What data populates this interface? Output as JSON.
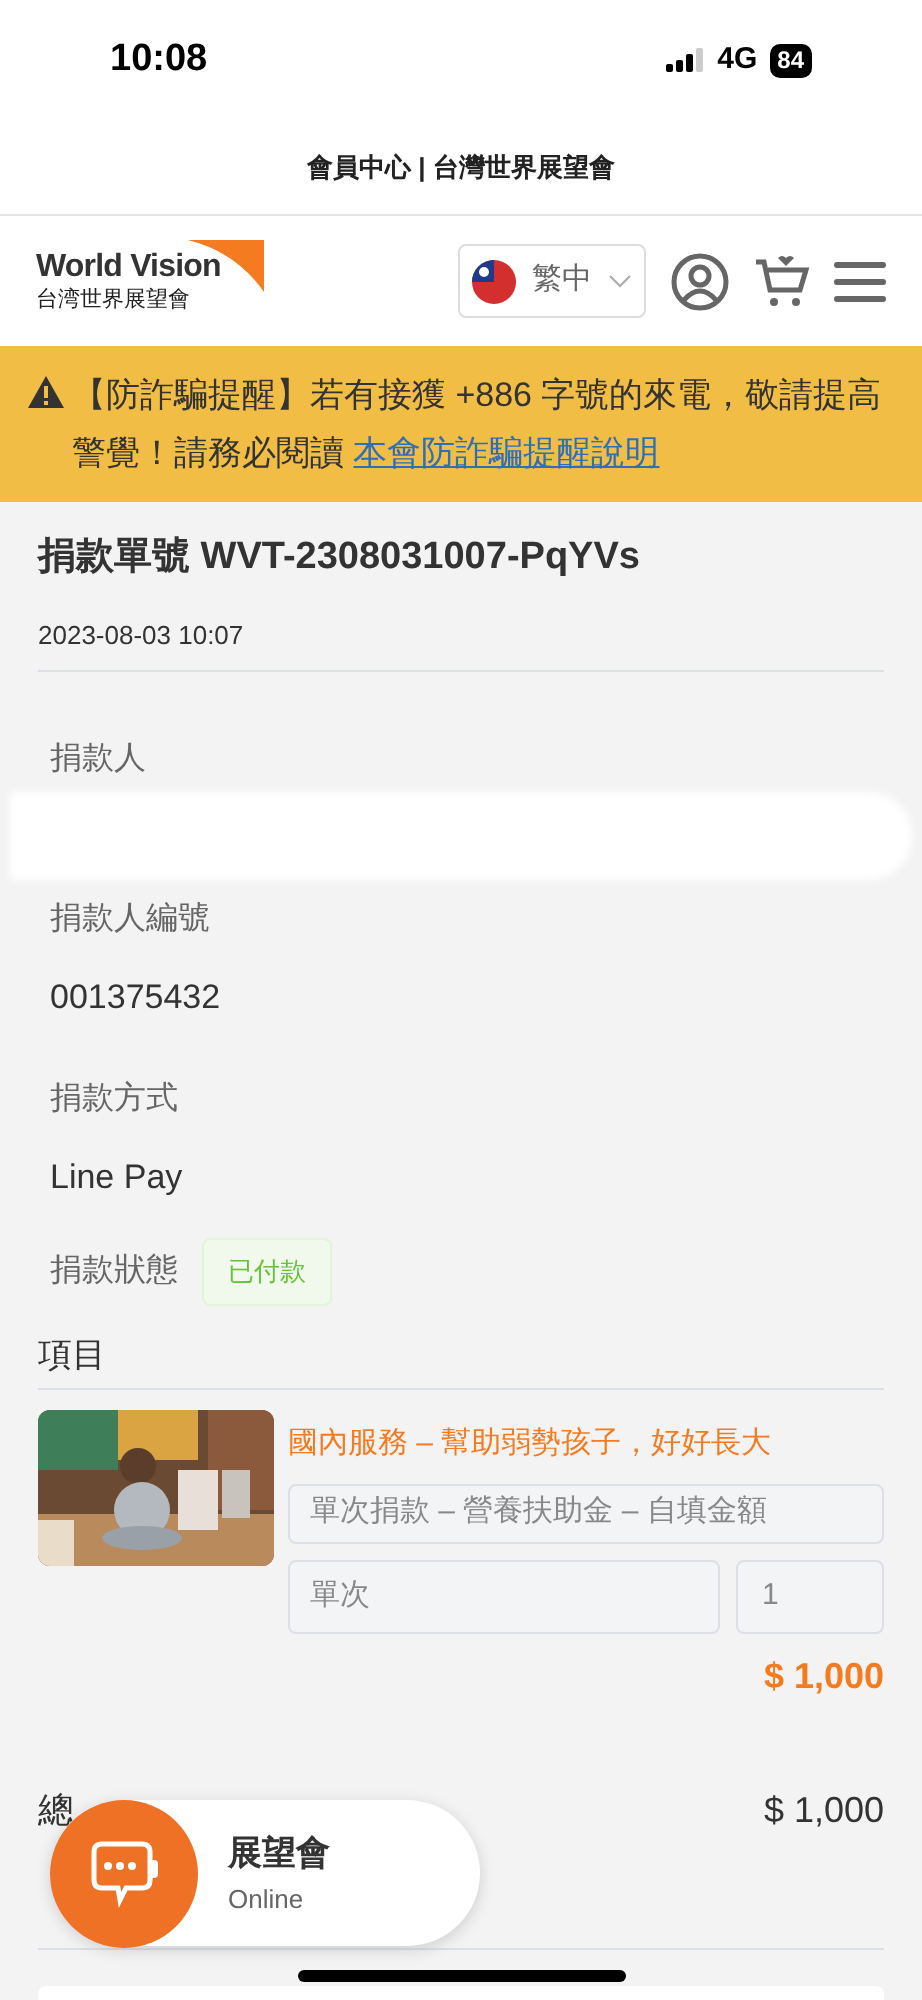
{
  "status_bar": {
    "time": "10:08",
    "network": "4G",
    "battery": "84"
  },
  "site_title": "會員中心 | 台灣世界展望會",
  "header": {
    "logo_text": "World Vision",
    "logo_subtitle": "台湾世界展望會",
    "language": "繁中"
  },
  "alert": {
    "text": "【防詐騙提醒】若有接獲 +886 字號的來電，敬請提高警覺！請務必閱讀",
    "link": "本會防詐騙提醒說明"
  },
  "order": {
    "title": "捐款單號 WVT-2308031007-PqYVs",
    "date": "2023-08-03 10:07"
  },
  "fields": [
    {
      "kind": "redacted",
      "label": "捐款人"
    },
    {
      "kind": "text",
      "label": "捐款人編號",
      "value": "001375432"
    },
    {
      "kind": "text",
      "label": "捐款方式",
      "value": "Line Pay"
    },
    {
      "kind": "badge",
      "label": "捐款狀態",
      "value": "已付款",
      "color": "#67c23a"
    }
  ],
  "items_heading": "項目",
  "items": [
    {
      "title": "國內服務 – 幫助弱勢孩子，好好長大",
      "plan": "單次捐款 – 營養扶助金 – 自填金額",
      "frequency": "單次",
      "quantity": "1",
      "price": "$ 1,000"
    }
  ],
  "total": {
    "label": "總",
    "value": "$ 1,000"
  },
  "chat": {
    "name": "展望會",
    "status": "Online"
  }
}
